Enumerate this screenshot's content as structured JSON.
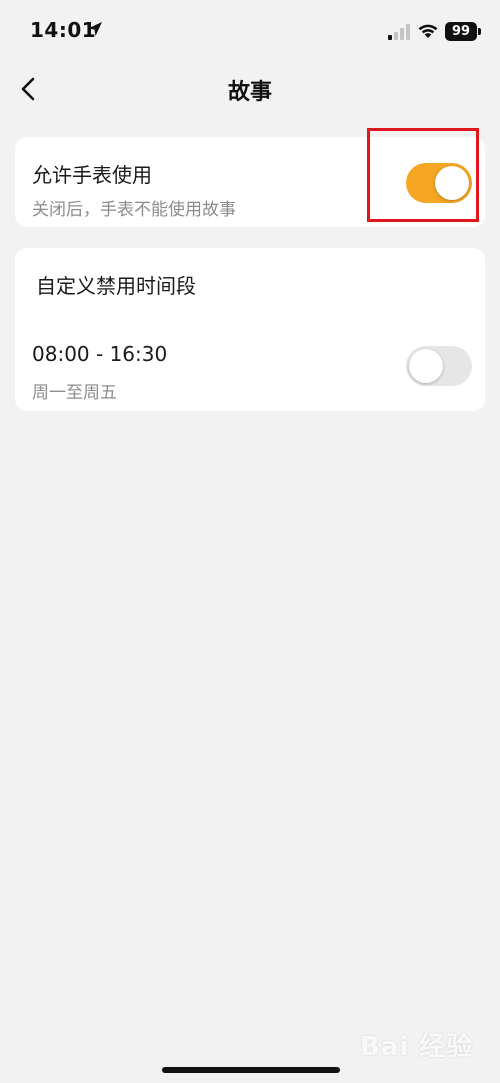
{
  "status_bar": {
    "time": "14:01",
    "battery": "99",
    "icons": [
      "location-arrow-icon",
      "cellular-signal-icon",
      "wifi-icon",
      "battery-icon"
    ]
  },
  "nav": {
    "title": "故事",
    "back_icon": "chevron-left-icon"
  },
  "allow_section": {
    "title": "允许手表使用",
    "subtitle": "关闭后，手表不能使用故事",
    "toggle_on": true,
    "toggle_color": "#f5a623"
  },
  "custom_section": {
    "title": "自定义禁用时间段",
    "schedule": {
      "time_range": "08:00 - 16:30",
      "days": "周一至周五",
      "toggle_on": false
    }
  },
  "annotation": {
    "highlight_color": "#e0161e"
  },
  "watermark": {
    "text": "Bai 经验"
  }
}
